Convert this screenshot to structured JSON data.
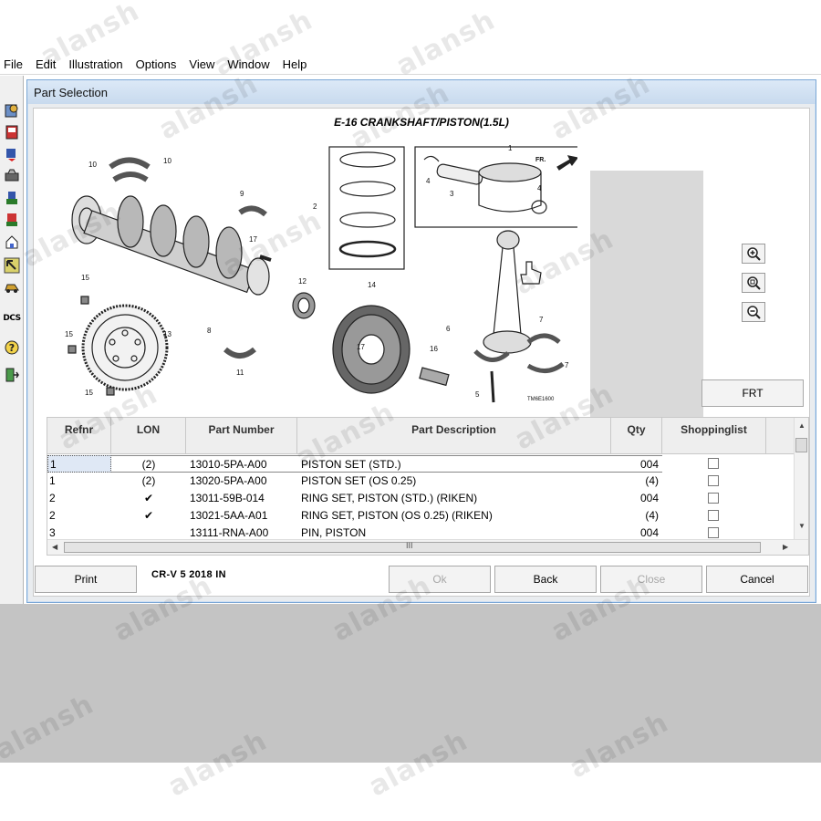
{
  "menu": [
    "File",
    "Edit",
    "Illustration",
    "Options",
    "View",
    "Window",
    "Help"
  ],
  "dialog": {
    "title": "Part Selection",
    "illustration_title": "E-16 CRANKSHAFT/PISTON(1.5L)",
    "illustration_code": "TM6E1600",
    "callouts": [
      "1",
      "2",
      "3",
      "4",
      "4",
      "5",
      "6",
      "7",
      "7",
      "8",
      "9",
      "10",
      "10",
      "11",
      "12",
      "13",
      "14",
      "15",
      "15",
      "15",
      "16",
      "17",
      "17"
    ],
    "fr_label": "FR.",
    "frt_button": "FRT"
  },
  "table": {
    "headers": [
      "Refnr",
      "LON",
      "Part Number",
      "Part Description",
      "Qty",
      "Shoppinglist"
    ],
    "rows": [
      {
        "ref": "1",
        "lon": "(2)",
        "part": "13010-5PA-A00",
        "desc": "PISTON SET (STD.)",
        "qty": "004"
      },
      {
        "ref": "1",
        "lon": "(2)",
        "part": "13020-5PA-A00",
        "desc": "PISTON SET (OS 0.25)",
        "qty": "(4)"
      },
      {
        "ref": "2",
        "lon": "✔",
        "part": "13011-59B-014",
        "desc": "RING SET, PISTON (STD.) (RIKEN)",
        "qty": "004"
      },
      {
        "ref": "2",
        "lon": "✔",
        "part": "13021-5AA-A01",
        "desc": "RING SET, PISTON (OS 0.25) (RIKEN)",
        "qty": "(4)"
      },
      {
        "ref": "3",
        "lon": "",
        "part": "13111-RNA-A00",
        "desc": "PIN, PISTON",
        "qty": "004"
      }
    ],
    "hscroll_grip": "III"
  },
  "bottom": {
    "print": "Print",
    "model": "CR-V  5  2018  IN",
    "ok": "Ok",
    "back": "Back",
    "close": "Close",
    "cancel": "Cancel"
  },
  "toolbar_text": "DCS",
  "watermark": "alansh"
}
